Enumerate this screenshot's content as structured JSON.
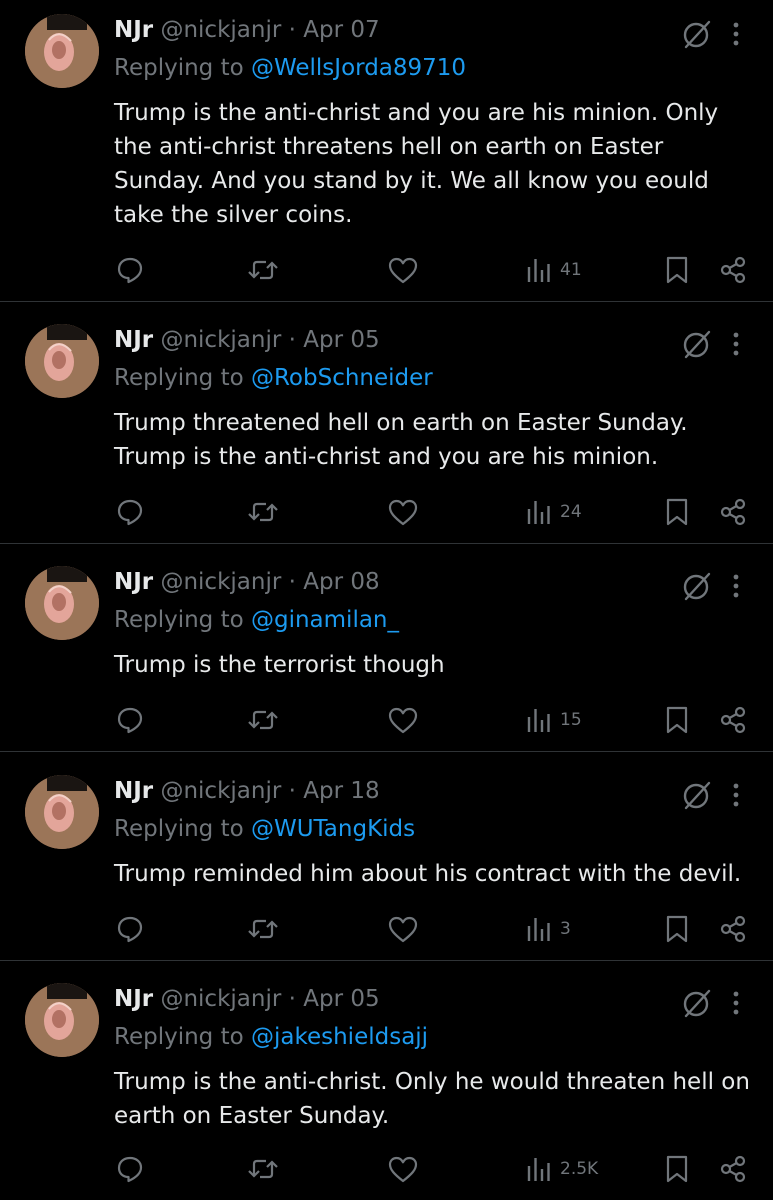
{
  "colors": {
    "background": "#000000",
    "text": "#e7e9ea",
    "muted": "#71767b",
    "mention": "#1d9bf0",
    "divider": "#2f3336"
  },
  "icons": {
    "reply": "reply-icon",
    "retweet": "retweet-icon",
    "like": "like-icon",
    "views": "views-icon",
    "bookmark": "bookmark-icon",
    "share": "share-icon",
    "grok": "grok-icon",
    "more": "more-icon"
  },
  "tweets": [
    {
      "name": "NJr",
      "handle": "@nickjanjr",
      "separator": "·",
      "date": "Apr 07",
      "replying_label": "Replying to",
      "replying_to": "@WellsJorda89710",
      "text": "Trump is the anti-christ and you are his minion. Only the anti-christ threatens hell on earth on Easter Sunday. And you stand by it. We all know you eould take the silver coins.",
      "views": "41"
    },
    {
      "name": "NJr",
      "handle": "@nickjanjr",
      "separator": "·",
      "date": "Apr 05",
      "replying_label": "Replying to",
      "replying_to": "@RobSchneider",
      "text": "Trump threatened hell on earth on Easter Sunday. Trump is the anti-christ and you are his minion.",
      "views": "24"
    },
    {
      "name": "NJr",
      "handle": "@nickjanjr",
      "separator": "·",
      "date": "Apr 08",
      "replying_label": "Replying to",
      "replying_to": "@ginamilan_",
      "text": "Trump is the terrorist though",
      "views": "15"
    },
    {
      "name": "NJr",
      "handle": "@nickjanjr",
      "separator": "·",
      "date": "Apr 18",
      "replying_label": "Replying to",
      "replying_to": "@WUTangKids",
      "text": "Trump reminded him about his contract with the devil.",
      "views": "3"
    },
    {
      "name": "NJr",
      "handle": "@nickjanjr",
      "separator": "·",
      "date": "Apr 05",
      "replying_label": "Replying to",
      "replying_to": "@jakeshieldsajj",
      "text": "Trump is the anti-christ. Only he would threaten hell on earth on Easter Sunday.",
      "views": "2.5K"
    }
  ]
}
